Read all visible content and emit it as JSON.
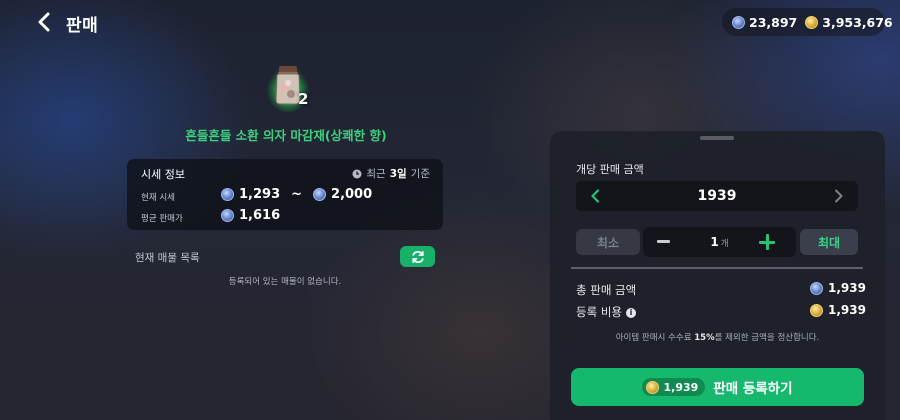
{
  "header": {
    "title": "판매",
    "blue_currency": "23,897",
    "gold_currency": "3,953,676"
  },
  "item": {
    "count": "2",
    "name": "흔들흔들 소환 의자 마감재(상쾌한 향)"
  },
  "market": {
    "title": "시세 정보",
    "basis_prefix": "최근",
    "basis_days": "3일",
    "basis_suffix": "기준",
    "current_label": "현재 시세",
    "current_min": "1,293",
    "range_sep": "~",
    "current_max": "2,000",
    "avg_label": "평균 판매가",
    "avg_value": "1,616"
  },
  "listings": {
    "label": "현재 매물 목록",
    "empty_message": "등록되어 있는 매물이 없습니다."
  },
  "sell": {
    "unit_price_label": "개당 판매 금액",
    "unit_price": "1939",
    "min_label": "최소",
    "max_label": "최대",
    "quantity": "1",
    "quantity_unit": "개",
    "total_label": "총 판매 금액",
    "total_value": "1,939",
    "fee_label": "등록 비용",
    "fee_value": "1,939",
    "fee_note_prefix": "아이템 판매시 수수료",
    "fee_note_rate": "15%",
    "fee_note_suffix": "를 제외한 금액을 정산합니다.",
    "register_cost": "1,939",
    "register_label": "판매 등록하기"
  },
  "colors": {
    "accent_green": "#16b86d",
    "item_name_green": "#3fd07e",
    "panel_bg": "#1e2129"
  },
  "icons": [
    "back-arrow-icon",
    "blue-gem-icon",
    "gold-coin-icon",
    "clock-icon",
    "refresh-icon",
    "chevron-left-icon",
    "chevron-right-icon",
    "minus-icon",
    "plus-icon",
    "info-icon"
  ]
}
